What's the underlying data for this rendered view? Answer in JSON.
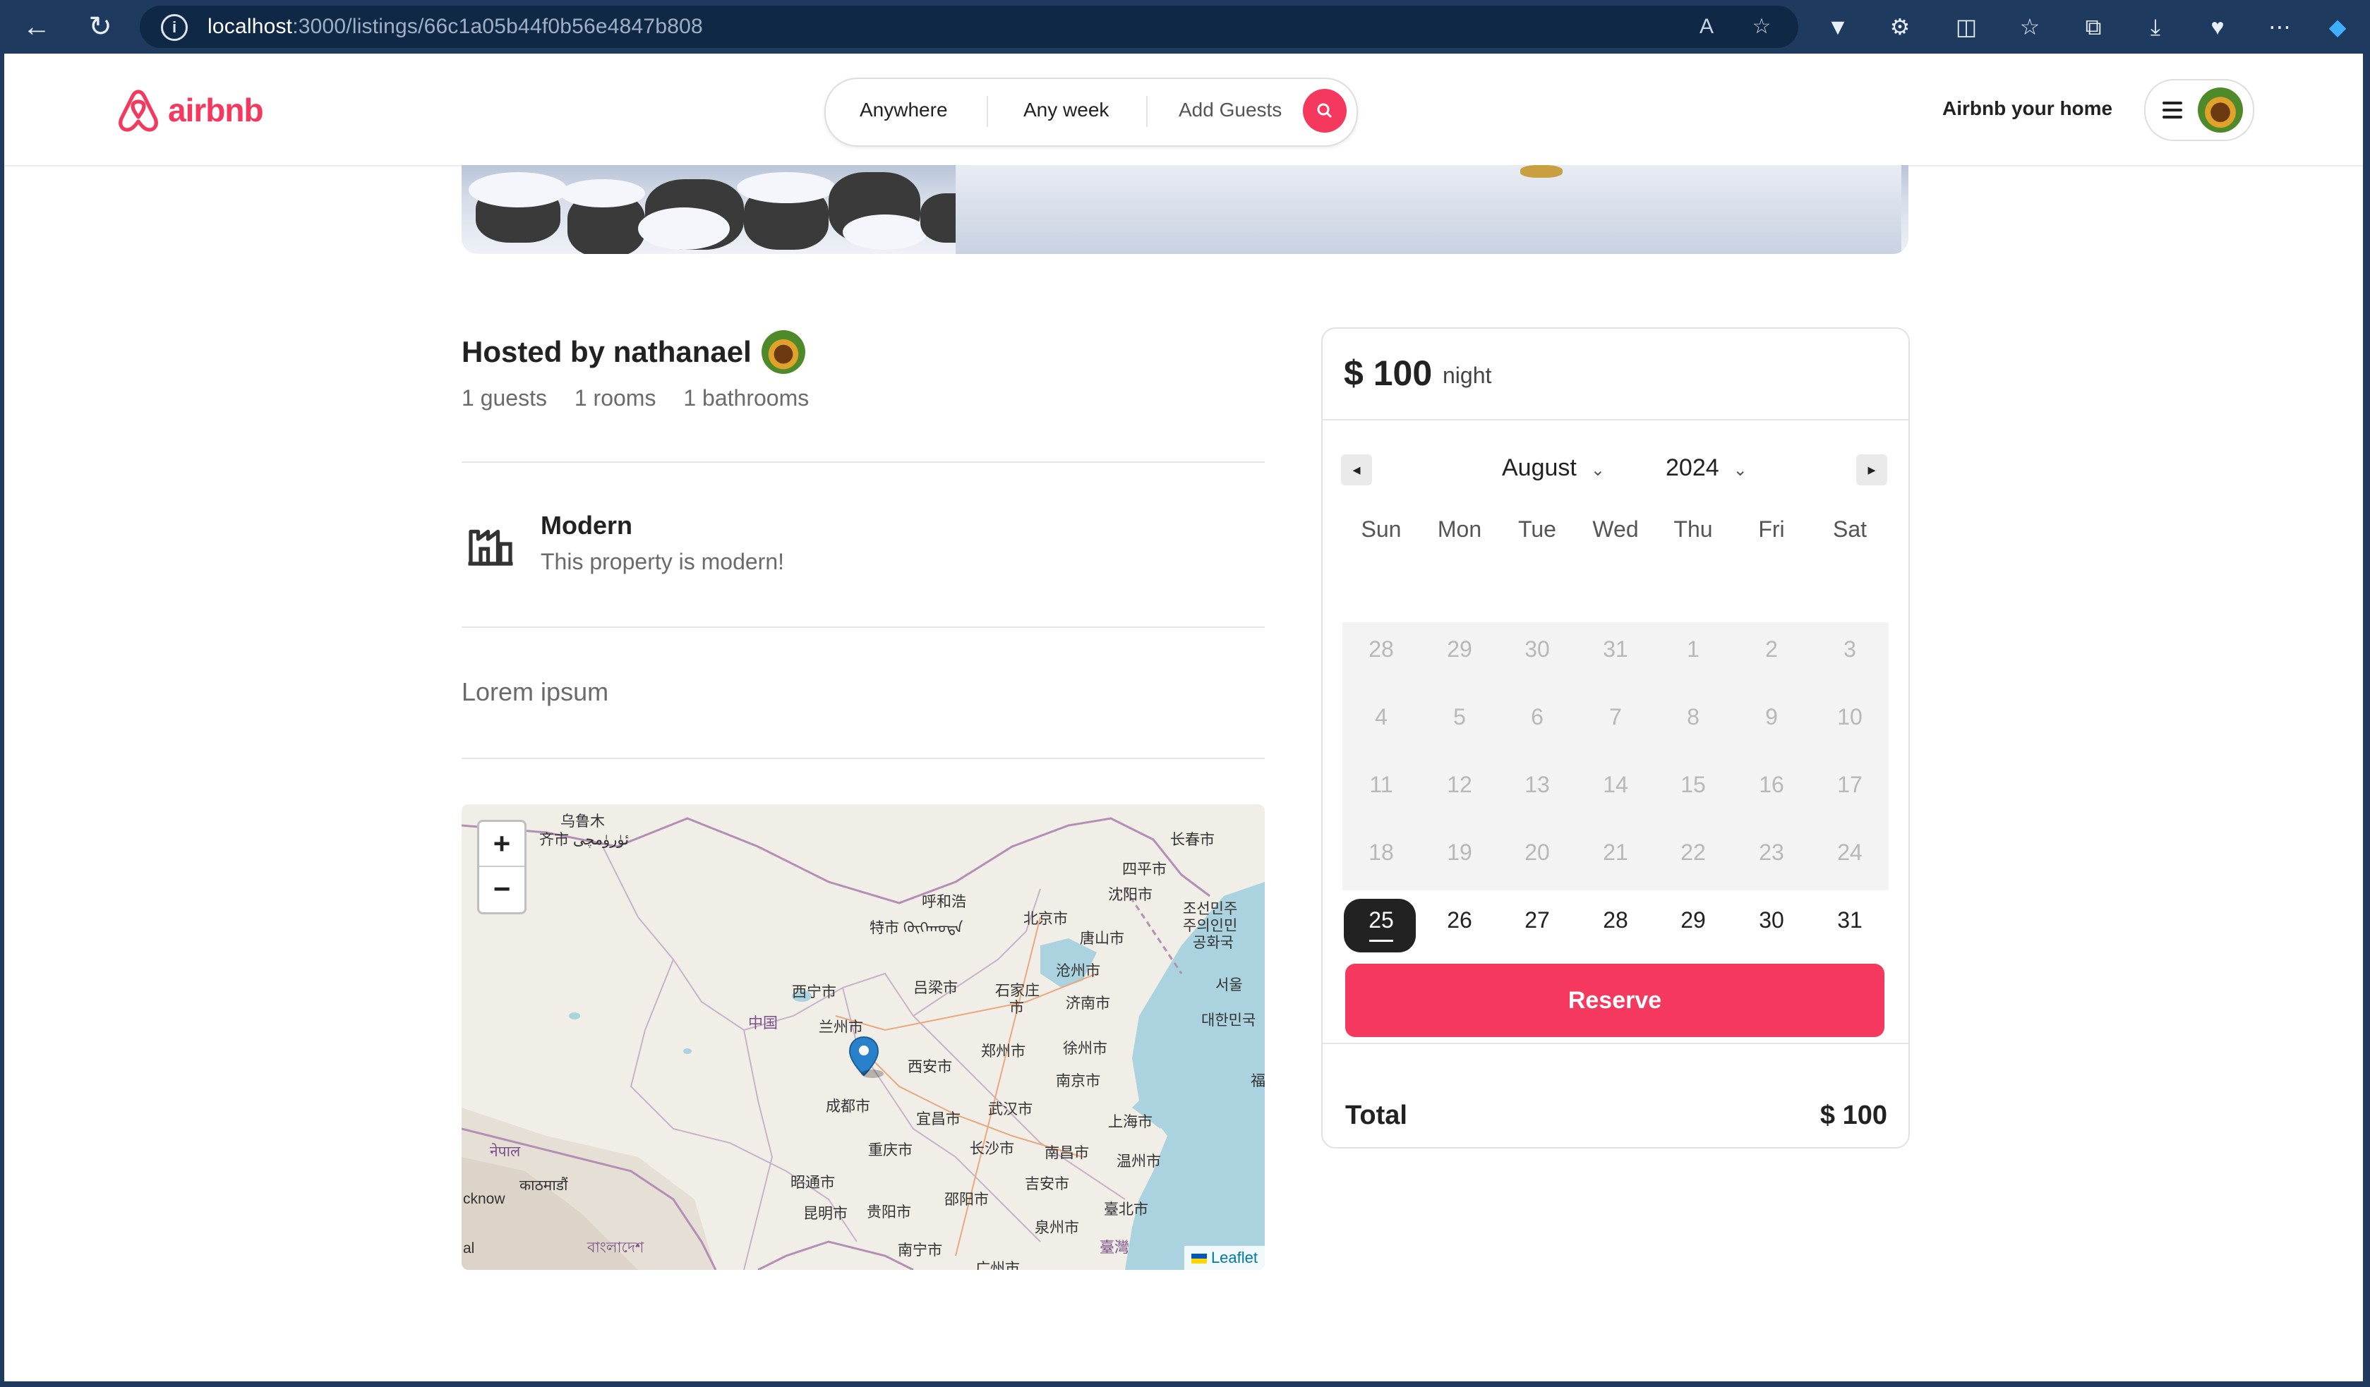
{
  "browser": {
    "url_host": "localhost",
    "url_path": ":3000/listings/66c1a05b44f0b56e4847b808"
  },
  "header": {
    "brand": "airbnb",
    "search": {
      "where": "Anywhere",
      "when": "Any week",
      "guests": "Add Guests"
    },
    "host_link": "Airbnb your home"
  },
  "listing": {
    "hosted_by": "Hosted by nathanael",
    "stats": {
      "guests": "1 guests",
      "rooms": "1 rooms",
      "bathrooms": "1 bathrooms"
    },
    "category": {
      "title": "Modern",
      "description": "This property is modern!"
    },
    "description": "Lorem ipsum"
  },
  "map": {
    "zoom_in": "+",
    "zoom_out": "−",
    "attribution": "Leaflet",
    "labels": [
      "乌鲁木",
      "齐市 ئۈرۈمچى",
      "长春市",
      "四平市",
      "呼和浩",
      "沈阳市",
      "特市 ᠬᠥᠬᠡᠬᠣᠲᠠ",
      "北京市",
      "唐山市",
      "沧州市",
      "조선민주",
      "주의인민",
      "공화국",
      "西宁市",
      "吕梁市",
      "石家庄",
      "市",
      "济南市",
      "서울",
      "中国",
      "兰州市",
      "郑州市",
      "徐州市",
      "대한민국",
      "西安市",
      "南京市",
      "成都市",
      "宜昌市",
      "武汉市",
      "上海市",
      "नेपाल",
      "重庆市",
      "长沙市",
      "南昌市",
      "温州市",
      "काठमाडौं",
      "昭通市",
      "吉安市",
      "cknow",
      "昆明市",
      "贵阳市",
      "邵阳市",
      "臺北市",
      "泉州市",
      "al",
      "বাংলাদেশ",
      "南宁市",
      "臺灣",
      "广州市",
      "福"
    ],
    "colors": {
      "marker": "#2a81cb",
      "water": "#aad3df",
      "land": "#f1eee8"
    }
  },
  "booking": {
    "price": "$ 100",
    "per": "night",
    "month": "August",
    "year": "2024",
    "weekdays": [
      "Sun",
      "Mon",
      "Tue",
      "Wed",
      "Thu",
      "Fri",
      "Sat"
    ],
    "weeks": [
      [
        "28",
        "29",
        "30",
        "31",
        "1",
        "2",
        "3"
      ],
      [
        "4",
        "5",
        "6",
        "7",
        "8",
        "9",
        "10"
      ],
      [
        "11",
        "12",
        "13",
        "14",
        "15",
        "16",
        "17"
      ],
      [
        "18",
        "19",
        "20",
        "21",
        "22",
        "23",
        "24"
      ],
      [
        "25",
        "26",
        "27",
        "28",
        "29",
        "30",
        "31"
      ]
    ],
    "selected_day": "25",
    "reserve_label": "Reserve",
    "total_label": "Total",
    "total_value": "$ 100"
  },
  "colors": {
    "brand": "#f5385d",
    "text": "#222222",
    "muted": "#6a6a6a"
  }
}
